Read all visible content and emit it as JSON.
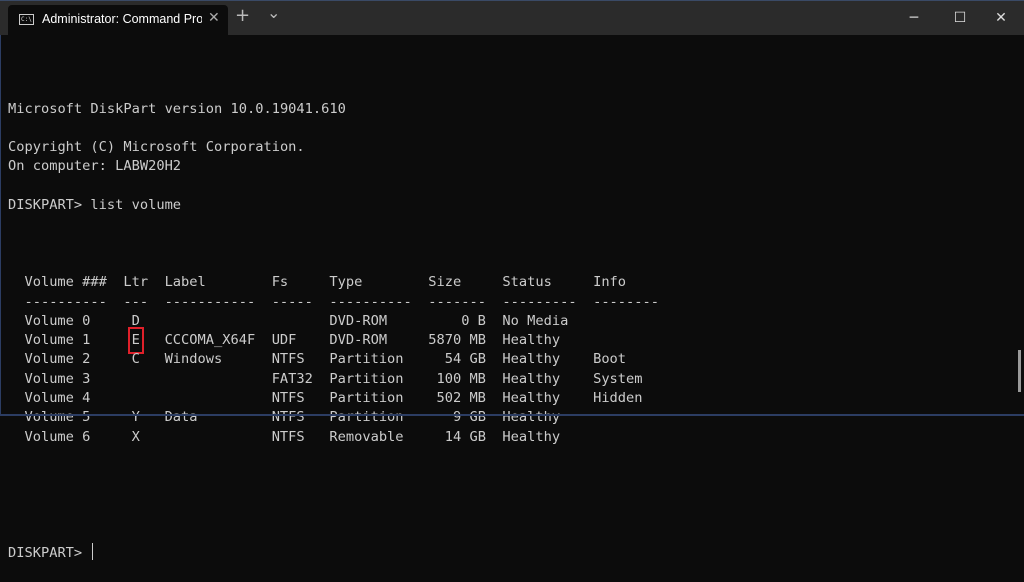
{
  "window": {
    "tab_title": "Administrator: Command Prompt",
    "tab_icon_text": "C:\\",
    "new_tab": "+",
    "dropdown": "⌄",
    "minimize": "─",
    "maximize": "☐",
    "close": "✕",
    "tab_close": "✕"
  },
  "console": {
    "intro": [
      "Microsoft DiskPart version 10.0.19041.610",
      "",
      "Copyright (C) Microsoft Corporation.",
      "On computer: LABW20H2",
      "",
      "DISKPART> list volume",
      ""
    ],
    "prompt": "DISKPART> ",
    "table": {
      "headers": [
        "Volume ###",
        "Ltr",
        "Label",
        "Fs",
        "Type",
        "Size",
        "Status",
        "Info"
      ],
      "separators": [
        "----------",
        "---",
        "-----------",
        "-----",
        "----------",
        "-------",
        "---------",
        "--------"
      ],
      "rows": [
        [
          "Volume 0",
          "D",
          "",
          "",
          "DVD-ROM",
          "0 B",
          "No Media",
          ""
        ],
        [
          "Volume 1",
          "E",
          "CCCOMA_X64F",
          "UDF",
          "DVD-ROM",
          "5870 MB",
          "Healthy",
          ""
        ],
        [
          "Volume 2",
          "C",
          "Windows",
          "NTFS",
          "Partition",
          "54 GB",
          "Healthy",
          "Boot"
        ],
        [
          "Volume 3",
          "",
          "",
          "FAT32",
          "Partition",
          "100 MB",
          "Healthy",
          "System"
        ],
        [
          "Volume 4",
          "",
          "",
          "NTFS",
          "Partition",
          "502 MB",
          "Healthy",
          "Hidden"
        ],
        [
          "Volume 5",
          "Y",
          "Data",
          "NTFS",
          "Partition",
          "9 GB",
          "Healthy",
          ""
        ],
        [
          "Volume 6",
          "X",
          "",
          "NTFS",
          "Removable",
          "14 GB",
          "Healthy",
          ""
        ]
      ],
      "highlighted_cell": "E"
    }
  },
  "colors": {
    "highlight": "#e0202a",
    "text": "#cccccc",
    "background": "#0c0c0c"
  }
}
